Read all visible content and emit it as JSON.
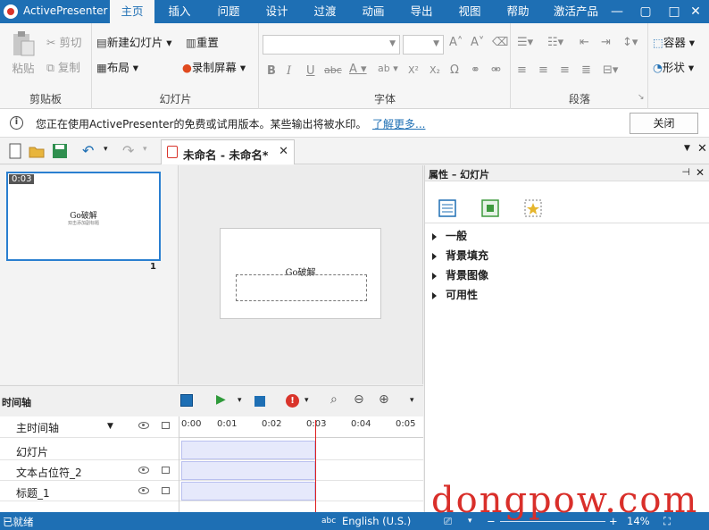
{
  "app": {
    "name": "ActivePresenter"
  },
  "menu": [
    "主页",
    "插入",
    "问题",
    "设计",
    "过渡",
    "动画",
    "导出",
    "视图",
    "帮助",
    "激活产品"
  ],
  "ribbon": {
    "clipboard": {
      "label": "剪贴板",
      "paste": "粘贴",
      "cut": "剪切",
      "copy": "复制"
    },
    "slides": {
      "label": "幻灯片",
      "new_slide": "新建幻灯片",
      "reset": "重置",
      "layout": "布局",
      "record": "录制屏幕"
    },
    "font": {
      "label": "字体"
    },
    "paragraph": {
      "label": "段落"
    },
    "drawing": {
      "container": "容器",
      "shape": "形状"
    }
  },
  "info": {
    "message": "您正在使用ActivePresenter的免费或试用版本。某些输出将被水印。",
    "more_link": "了解更多...",
    "close": "关闭"
  },
  "doc": {
    "tab_title": "未命名 - 未命名*"
  },
  "slidepanel": {
    "time": "0:03",
    "number": "1",
    "thumb_title": "Go破解",
    "thumb_sub": "双击添加副标题"
  },
  "canvas": {
    "slide_title": "Go破解"
  },
  "properties": {
    "header": "属性 – 幻灯片",
    "sections": [
      "一般",
      "背景填充",
      "背景图像",
      "可用性"
    ]
  },
  "timeline": {
    "label": "时间轴",
    "main": "主时间轴",
    "ticks": [
      "0:00",
      "0:01",
      "0:02",
      "0:03",
      "0:04",
      "0:05"
    ],
    "rows": [
      "幻灯片",
      "文本占位符_2",
      "标题_1"
    ]
  },
  "status": {
    "ready": "已就绪",
    "language": "English (U.S.)",
    "zoom": "14%"
  },
  "watermark": {
    "text": "dongpow.com"
  },
  "colors": {
    "accent": "#1e6fb4",
    "watermark": "#d92f2a",
    "playhead": "#e02020"
  }
}
